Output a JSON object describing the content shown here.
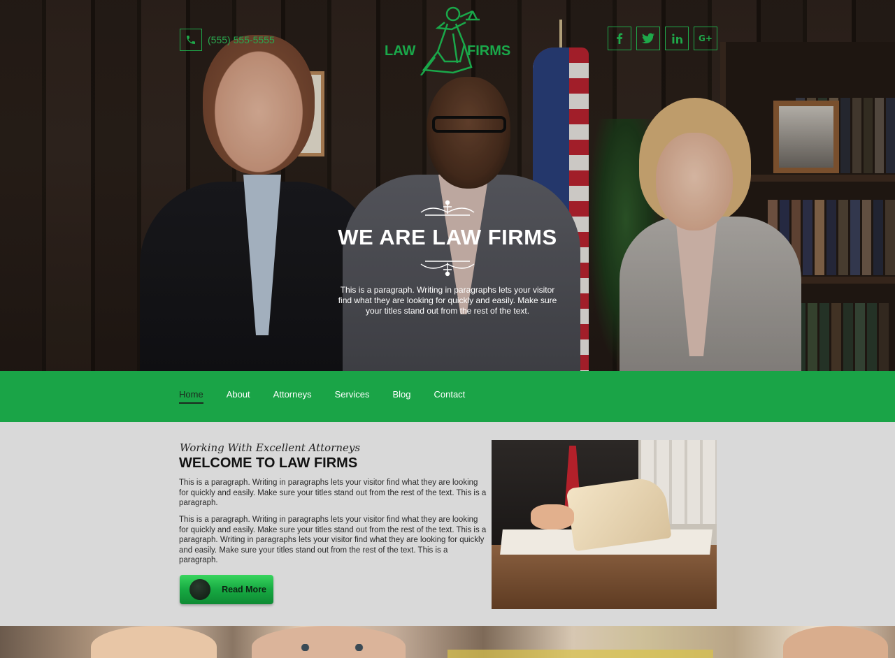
{
  "header": {
    "phone": "(555) 555-5555",
    "logo": {
      "left": "LAW",
      "right": "FIRMS"
    },
    "social": [
      {
        "name": "facebook-icon",
        "glyph": "f"
      },
      {
        "name": "twitter-icon",
        "glyph": "🐦"
      },
      {
        "name": "linkedin-icon",
        "glyph": "in"
      },
      {
        "name": "google-plus-icon",
        "glyph": "G+"
      }
    ],
    "accent_color": "#1aa84a"
  },
  "hero": {
    "title": "WE ARE LAW FIRMS",
    "text": "This is a paragraph. Writing in paragraphs lets your visitor find what they are looking for quickly and easily. Make sure your titles stand out from the rest of the text."
  },
  "nav": {
    "items": [
      {
        "label": "Home",
        "active": true
      },
      {
        "label": "About",
        "active": false
      },
      {
        "label": "Attorneys",
        "active": false
      },
      {
        "label": "Services",
        "active": false
      },
      {
        "label": "Blog",
        "active": false
      },
      {
        "label": "Contact",
        "active": false
      }
    ],
    "background": "#1aa447"
  },
  "welcome": {
    "subtitle": "Working With Excellent Attorneys",
    "title": "WELCOME TO LAW FIRMS",
    "paragraphs": [
      "This is a paragraph. Writing in paragraphs lets your visitor find what they are looking for quickly and easily. Make sure your titles stand out from the rest of the text. This is a paragraph.",
      "This is a paragraph. Writing in paragraphs lets your visitor find what they are looking for quickly and easily. Make sure your titles stand out from the rest of the text. This is a paragraph. Writing in paragraphs lets your visitor find what they are looking for quickly and easily. Make sure your titles stand out from the rest of the text. This is a paragraph."
    ],
    "button": "Read More"
  }
}
